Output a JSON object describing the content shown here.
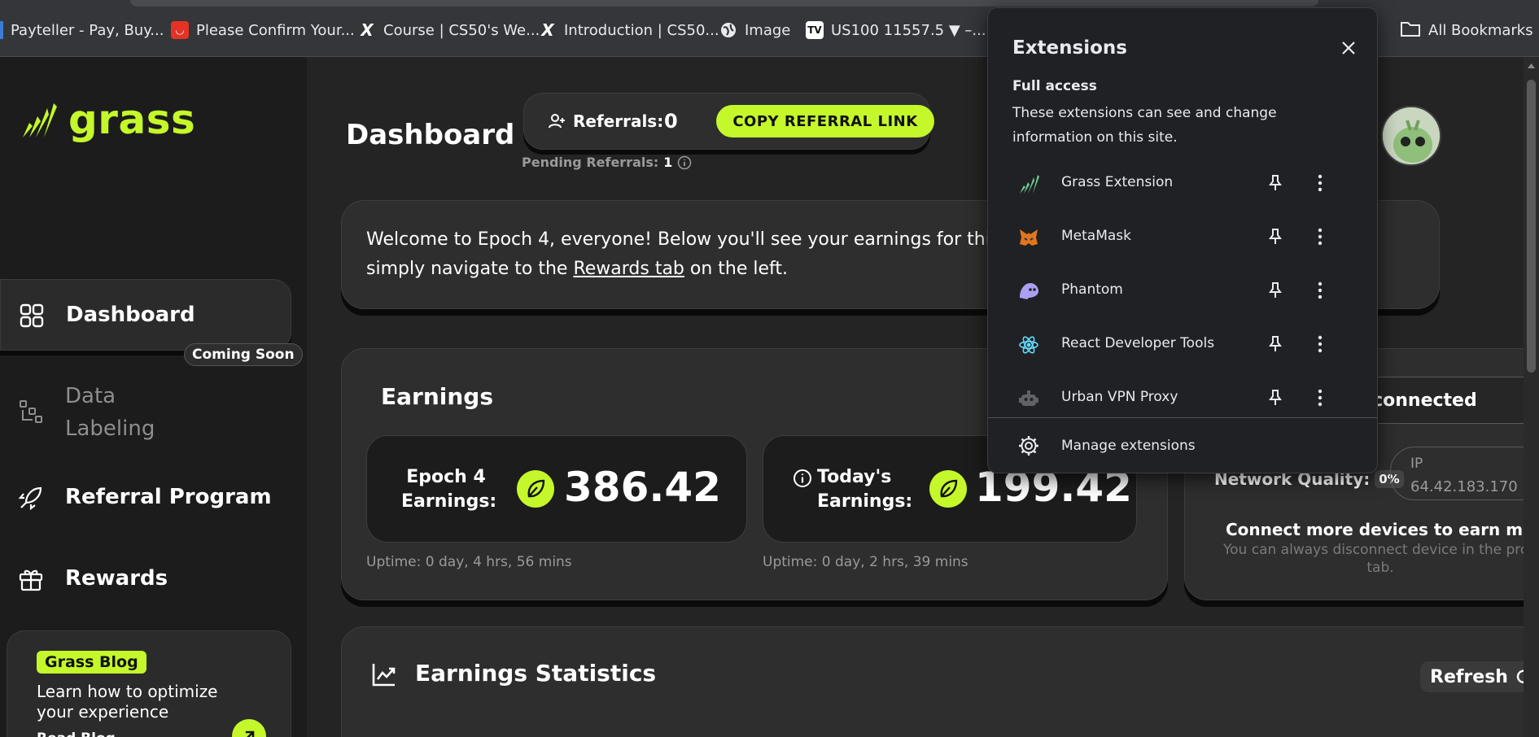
{
  "bookmarks": [
    {
      "label": "Payteller - Pay, Buy...",
      "icon": "payteller-icon",
      "color": "#3b7bd8"
    },
    {
      "label": "Please Confirm Your...",
      "icon": "aliexpress-icon",
      "color": "#e43225"
    },
    {
      "label": "Course | CS50's We...",
      "icon": "cs50-icon",
      "color": "#ffffff"
    },
    {
      "label": "Introduction | CS50...",
      "icon": "cs50-icon",
      "color": "#ffffff"
    },
    {
      "label": "Image",
      "icon": "globe-icon",
      "color": "#e8eaed"
    },
    {
      "label": "US100 11557.5 ▼ –...",
      "icon": "tradingview-icon",
      "color": "#ffffff"
    }
  ],
  "all_bookmarks": "All Bookmarks",
  "brand": {
    "name": "grass",
    "accent": "#c4f82a"
  },
  "sidebar": {
    "items": [
      {
        "label": "Dashboard",
        "icon": "grid-icon"
      },
      {
        "label": "Data\nLabeling",
        "icon": "data-labeling-icon",
        "badge": "Coming Soon"
      },
      {
        "label": "Referral Program",
        "icon": "rocket-icon"
      },
      {
        "label": "Rewards",
        "icon": "gift-icon"
      }
    ],
    "blog": {
      "tag": "Grass Blog",
      "text": "Learn how to optimize your experience",
      "link": "Read Blog"
    }
  },
  "header": {
    "title": "Dashboard",
    "referrals_label": "Referrals:",
    "referrals_count": "0",
    "copy_button": "COPY REFERRAL LINK",
    "pending_label": "Pending Referrals:",
    "pending_count": "1"
  },
  "welcome": {
    "line1": "Welcome to Epoch 4, everyone! Below you'll see your earnings for this e",
    "line2_before": "simply navigate to the ",
    "line2_link": "Rewards tab",
    "line2_after": " on the left."
  },
  "earnings": {
    "title": "Earnings",
    "epoch_label_1": "Epoch 4",
    "epoch_label_2": "Earnings:",
    "epoch_value": "386.42",
    "epoch_uptime": "Uptime: 0 day, 4 hrs, 56 mins",
    "today_label_1": "Today's",
    "today_label_2": "Earnings:",
    "today_value": "199.42",
    "today_uptime": "Uptime: 0 day, 2 hrs, 39 mins"
  },
  "device": {
    "status": "sconnected",
    "network_quality_label": "Network Quality:",
    "network_quality_value": "0%",
    "ip_label": "IP",
    "ip_value": "64.42.183.170",
    "connect_more": "Connect more devices to earn more.",
    "connect_sub": "You can always disconnect device in the profi tab."
  },
  "stats": {
    "title": "Earnings Statistics",
    "refresh": "Refresh"
  },
  "extensions_popup": {
    "title": "Extensions",
    "section": "Full access",
    "description": "These extensions can see and change information on this site.",
    "items": [
      {
        "name": "Grass Extension",
        "icon": "grass-icon"
      },
      {
        "name": "MetaMask",
        "icon": "metamask-icon"
      },
      {
        "name": "Phantom",
        "icon": "phantom-icon"
      },
      {
        "name": "React Developer Tools",
        "icon": "react-icon"
      },
      {
        "name": "Urban VPN Proxy",
        "icon": "urban-vpn-icon"
      }
    ],
    "manage": "Manage extensions"
  }
}
